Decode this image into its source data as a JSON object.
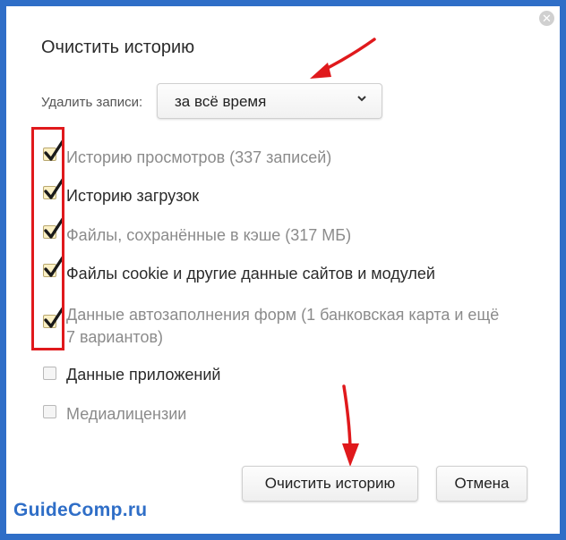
{
  "dialog": {
    "title": "Очистить историю",
    "close_icon": "close-icon"
  },
  "period": {
    "label": "Удалить записи:",
    "selected": "за всё время"
  },
  "options": [
    {
      "label": "Историю просмотров (337 записей)",
      "checked": true
    },
    {
      "label": "Историю загрузок",
      "checked": true
    },
    {
      "label": "Файлы, сохранённые в кэше (317 МБ)",
      "checked": true
    },
    {
      "label": "Файлы cookie и другие данные сайтов и модулей",
      "checked": true
    },
    {
      "label_line1": "Данные автозаполнения форм (1 банковская карта и ещё",
      "label_line2": "7 вариантов)",
      "checked": true
    },
    {
      "label": "Данные приложений",
      "checked": false
    },
    {
      "label": "Медиалицензии",
      "checked": false
    }
  ],
  "buttons": {
    "clear": "Очистить историю",
    "cancel": "Отмена"
  },
  "watermark": "GuideComp.ru",
  "colors": {
    "frame": "#2f6ec7",
    "annotation_red": "#e0191c",
    "checkbox_checked_fill": "#fbf0c4"
  }
}
